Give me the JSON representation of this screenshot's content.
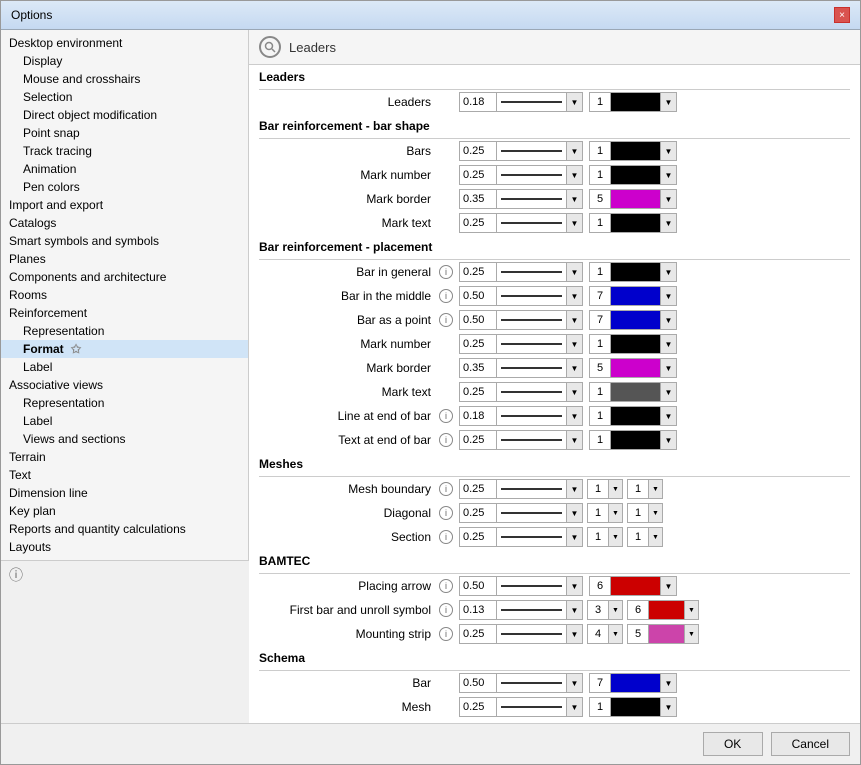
{
  "dialog": {
    "title": "Options",
    "close_label": "×"
  },
  "sidebar": {
    "items": [
      {
        "id": "desktop-env",
        "label": "Desktop environment",
        "indent": 0,
        "bold": false
      },
      {
        "id": "display",
        "label": "Display",
        "indent": 1,
        "bold": false
      },
      {
        "id": "mouse-crosshairs",
        "label": "Mouse and crosshairs",
        "indent": 1,
        "bold": false
      },
      {
        "id": "selection",
        "label": "Selection",
        "indent": 1,
        "bold": false
      },
      {
        "id": "direct-object",
        "label": "Direct object modification",
        "indent": 1,
        "bold": false
      },
      {
        "id": "point-snap",
        "label": "Point snap",
        "indent": 1,
        "bold": false
      },
      {
        "id": "track-tracing",
        "label": "Track tracing",
        "indent": 1,
        "bold": false
      },
      {
        "id": "animation",
        "label": "Animation",
        "indent": 1,
        "bold": false
      },
      {
        "id": "pen-colors",
        "label": "Pen colors",
        "indent": 1,
        "bold": false
      },
      {
        "id": "import-export",
        "label": "Import and export",
        "indent": 0,
        "bold": false
      },
      {
        "id": "catalogs",
        "label": "Catalogs",
        "indent": 0,
        "bold": false
      },
      {
        "id": "smart-symbols",
        "label": "Smart symbols and symbols",
        "indent": 0,
        "bold": false
      },
      {
        "id": "planes",
        "label": "Planes",
        "indent": 0,
        "bold": false
      },
      {
        "id": "components",
        "label": "Components and architecture",
        "indent": 0,
        "bold": false
      },
      {
        "id": "rooms",
        "label": "Rooms",
        "indent": 0,
        "bold": false
      },
      {
        "id": "reinforcement",
        "label": "Reinforcement",
        "indent": 0,
        "bold": false
      },
      {
        "id": "representation",
        "label": "Representation",
        "indent": 1,
        "bold": false
      },
      {
        "id": "format",
        "label": "Format",
        "indent": 1,
        "bold": true,
        "star": true
      },
      {
        "id": "label",
        "label": "Label",
        "indent": 1,
        "bold": false
      },
      {
        "id": "associative-views",
        "label": "Associative views",
        "indent": 0,
        "bold": false
      },
      {
        "id": "assoc-representation",
        "label": "Representation",
        "indent": 1,
        "bold": false
      },
      {
        "id": "assoc-label",
        "label": "Label",
        "indent": 1,
        "bold": false
      },
      {
        "id": "views-sections",
        "label": "Views and sections",
        "indent": 1,
        "bold": false
      },
      {
        "id": "terrain",
        "label": "Terrain",
        "indent": 0,
        "bold": false
      },
      {
        "id": "text",
        "label": "Text",
        "indent": 0,
        "bold": false
      },
      {
        "id": "dimension-line",
        "label": "Dimension line",
        "indent": 0,
        "bold": false
      },
      {
        "id": "key-plan",
        "label": "Key plan",
        "indent": 0,
        "bold": false
      },
      {
        "id": "reports",
        "label": "Reports and quantity calculations",
        "indent": 0,
        "bold": false
      },
      {
        "id": "layouts",
        "label": "Layouts",
        "indent": 0,
        "bold": false
      }
    ],
    "info_label": "ⓘ"
  },
  "main": {
    "search_placeholder": "",
    "panel_title": "Leaders",
    "sections": [
      {
        "id": "leaders",
        "title": "Leaders",
        "properties": [
          {
            "label": "Leaders",
            "has_info": false,
            "value": "0.18",
            "slider_pct": 30,
            "number": "1",
            "color": "black"
          }
        ]
      },
      {
        "id": "bar-reinforcement-shape",
        "title": "Bar reinforcement - bar shape",
        "properties": [
          {
            "label": "Bars",
            "has_info": false,
            "value": "0.25",
            "slider_pct": 40,
            "number": "1",
            "color": "black"
          },
          {
            "label": "Mark number",
            "has_info": false,
            "value": "0.25",
            "slider_pct": 40,
            "number": "1",
            "color": "black"
          },
          {
            "label": "Mark border",
            "has_info": false,
            "value": "0.35",
            "slider_pct": 55,
            "number": "5",
            "color": "magenta"
          },
          {
            "label": "Mark text",
            "has_info": false,
            "value": "0.25",
            "slider_pct": 40,
            "number": "1",
            "color": "black"
          }
        ]
      },
      {
        "id": "bar-reinforcement-placement",
        "title": "Bar reinforcement - placement",
        "properties": [
          {
            "label": "Bar in general",
            "has_info": true,
            "value": "0.25",
            "slider_pct": 40,
            "number": "1",
            "color": "black"
          },
          {
            "label": "Bar in the middle",
            "has_info": true,
            "value": "0.50",
            "slider_pct": 65,
            "number": "7",
            "color": "blue"
          },
          {
            "label": "Bar as a point",
            "has_info": true,
            "value": "0.50",
            "slider_pct": 65,
            "number": "7",
            "color": "blue"
          },
          {
            "label": "Mark number",
            "has_info": false,
            "value": "0.25",
            "slider_pct": 40,
            "number": "1",
            "color": "black"
          },
          {
            "label": "Mark border",
            "has_info": false,
            "value": "0.35",
            "slider_pct": 55,
            "number": "5",
            "color": "magenta"
          },
          {
            "label": "Mark text",
            "has_info": false,
            "value": "0.25",
            "slider_pct": 40,
            "number": "1",
            "color": "mixed"
          },
          {
            "label": "Line at end of bar",
            "has_info": true,
            "value": "0.18",
            "slider_pct": 30,
            "number": "1",
            "color": "black"
          },
          {
            "label": "Text at end of bar",
            "has_info": true,
            "value": "0.25",
            "slider_pct": 40,
            "number": "1",
            "color": "black"
          }
        ]
      },
      {
        "id": "meshes",
        "title": "Meshes",
        "properties": [
          {
            "label": "Mesh boundary",
            "has_info": true,
            "value": "0.25",
            "slider_pct": 40,
            "number1": "1",
            "number2": "1",
            "triple": true
          },
          {
            "label": "Diagonal",
            "has_info": true,
            "value": "0.25",
            "slider_pct": 40,
            "number1": "1",
            "number2": "1",
            "triple": true
          },
          {
            "label": "Section",
            "has_info": true,
            "value": "0.25",
            "slider_pct": 40,
            "number1": "1",
            "number2": "1",
            "triple": true
          }
        ]
      },
      {
        "id": "bamtec",
        "title": "BAMTEC",
        "properties": [
          {
            "label": "Placing arrow",
            "has_info": true,
            "value": "0.50",
            "slider_pct": 65,
            "number": "6",
            "color": "red"
          },
          {
            "label": "First bar and unroll symbol",
            "has_info": true,
            "value": "0.13",
            "slider_pct": 20,
            "number1": "3",
            "number2": "6",
            "color2": "red",
            "triple_special": true
          },
          {
            "label": "Mounting strip",
            "has_info": true,
            "value": "0.25",
            "slider_pct": 40,
            "number1": "4",
            "number2": "5",
            "color2": "pink",
            "triple_special2": true
          }
        ]
      },
      {
        "id": "schema",
        "title": "Schema",
        "properties": [
          {
            "label": "Bar",
            "has_info": false,
            "value": "0.50",
            "slider_pct": 65,
            "number": "7",
            "color": "blue"
          },
          {
            "label": "Mesh",
            "has_info": false,
            "value": "0.25",
            "slider_pct": 40,
            "number": "1",
            "color": "black"
          }
        ]
      }
    ]
  },
  "buttons": {
    "ok_label": "OK",
    "cancel_label": "Cancel"
  }
}
